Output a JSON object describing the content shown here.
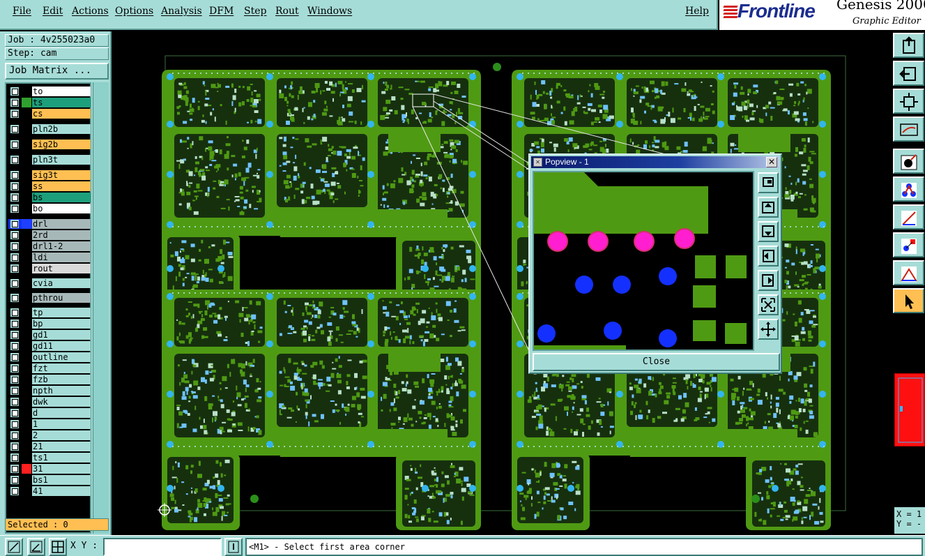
{
  "menubar": {
    "items": [
      "File",
      "Edit",
      "Actions",
      "Options",
      "Analysis",
      "DFM",
      "Step",
      "Rout",
      "Windows"
    ],
    "help": "Help"
  },
  "brand": {
    "company": "Frontline",
    "product": "Genesis 2000",
    "subtitle": "Graphic Editor"
  },
  "job": {
    "job_label": "Job : 4v255023a0",
    "step_label": "Step: cam",
    "matrix_button": "Job Matrix ..."
  },
  "layers": [
    {
      "name": "to",
      "bg": "#ffffff",
      "swatch": "#000000"
    },
    {
      "name": "ts",
      "bg": "#1e9f7c",
      "swatch": "#2fa02f"
    },
    {
      "name": "cs",
      "bg": "#ffbf52",
      "swatch": "#000000"
    },
    {
      "name": "pln2b",
      "bg": "#a6dcd7",
      "swatch": "#000000"
    },
    {
      "name": "sig2b",
      "bg": "#ffbf52",
      "swatch": "#000000"
    },
    {
      "name": "pln3t",
      "bg": "#a6dcd7",
      "swatch": "#000000"
    },
    {
      "name": "sig3t",
      "bg": "#ffbf52",
      "swatch": "#000000"
    },
    {
      "name": "ss",
      "bg": "#ffbf52",
      "swatch": "#000000"
    },
    {
      "name": "bs",
      "bg": "#1e9f7c",
      "swatch": "#000000"
    },
    {
      "name": "bo",
      "bg": "#ffffff",
      "swatch": "#000000"
    },
    {
      "name": "drl",
      "bg": "#a7b8b9",
      "swatch": "#1f3fff",
      "selected": true
    },
    {
      "name": "2rd",
      "bg": "#a7b8b9",
      "swatch": "#000000"
    },
    {
      "name": "drl1-2",
      "bg": "#a7b8b9",
      "swatch": "#000000"
    },
    {
      "name": "ldi",
      "bg": "#a7b8b9",
      "swatch": "#000000"
    },
    {
      "name": "rout",
      "bg": "#d9d9d9",
      "swatch": "#000000"
    },
    {
      "name": "cvia",
      "bg": "#a6dcd7",
      "swatch": "#000000"
    },
    {
      "name": "pthrou",
      "bg": "#a7b8b9",
      "swatch": "#000000"
    },
    {
      "name": "tp",
      "bg": "#a6dcd7",
      "swatch": "#000000"
    },
    {
      "name": "bp",
      "bg": "#a6dcd7",
      "swatch": "#000000"
    },
    {
      "name": "gd1",
      "bg": "#a6dcd7",
      "swatch": "#000000"
    },
    {
      "name": "gd11",
      "bg": "#a6dcd7",
      "swatch": "#000000"
    },
    {
      "name": "outline",
      "bg": "#a6dcd7",
      "swatch": "#000000"
    },
    {
      "name": "fzt",
      "bg": "#a6dcd7",
      "swatch": "#000000"
    },
    {
      "name": "fzb",
      "bg": "#a6dcd7",
      "swatch": "#000000"
    },
    {
      "name": "npth",
      "bg": "#a6dcd7",
      "swatch": "#000000"
    },
    {
      "name": "dwk",
      "bg": "#a6dcd7",
      "swatch": "#000000"
    },
    {
      "name": "d",
      "bg": "#a6dcd7",
      "swatch": "#000000"
    },
    {
      "name": "1",
      "bg": "#a6dcd7",
      "swatch": "#000000"
    },
    {
      "name": "2",
      "bg": "#a6dcd7",
      "swatch": "#000000"
    },
    {
      "name": "21",
      "bg": "#a6dcd7",
      "swatch": "#000000"
    },
    {
      "name": "ts1",
      "bg": "#a6dcd7",
      "swatch": "#000000"
    },
    {
      "name": "31",
      "bg": "#a6dcd7",
      "swatch": "#ff2020"
    },
    {
      "name": "bs1",
      "bg": "#a6dcd7",
      "swatch": "#000000"
    },
    {
      "name": "41",
      "bg": "#a6dcd7",
      "swatch": "#000000"
    }
  ],
  "status": {
    "selected": "Selected : 0",
    "xy_label": "X Y :",
    "xy_value": "",
    "prompt": "<M1> - Select first area corner",
    "coord_x": "X = 1",
    "coord_y": "Y = -"
  },
  "popview": {
    "title": "Popview - 1",
    "close_button": "Close"
  },
  "colors": {
    "panel": "#a6dcd7",
    "board_green": "#4f9a13",
    "pad_cyan": "#33b5f0",
    "pad_magenta": "#ff1fd0",
    "pad_blue": "#1430ff",
    "highlight_red": "#ff1010"
  },
  "icons": {
    "right_toolbar": [
      "layer-up-icon",
      "layer-left-icon",
      "fit-icon",
      "route-icon",
      "snap-icon",
      "network-icon",
      "measure-icon",
      "select-filter-icon",
      "ruler-icon",
      "pointer-icon"
    ],
    "popview_tools": [
      "zoom-window-icon",
      "pan-up-icon",
      "pan-down-icon",
      "pan-left-icon",
      "pan-right-icon",
      "zoom-in-icon",
      "zoom-out-icon"
    ],
    "bottom_buttons": [
      "snap-grid-icon",
      "snap-angle-icon",
      "grid-icon",
      "input-toggle-icon"
    ]
  }
}
